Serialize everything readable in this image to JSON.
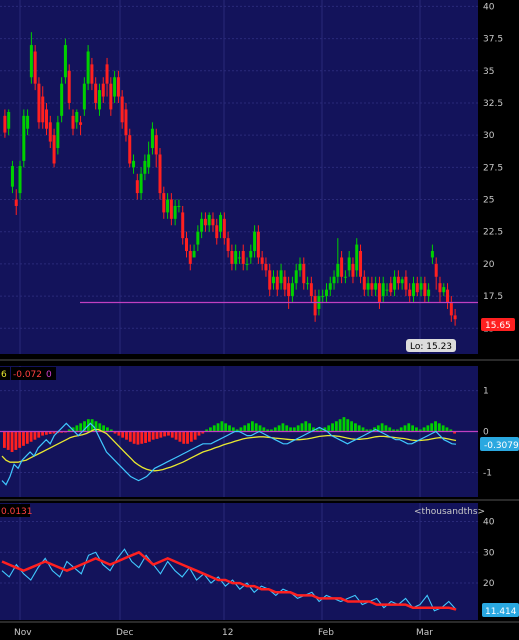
{
  "chart_data": [
    {
      "type": "candlestick",
      "panel": "price",
      "y_ticks": [
        "40",
        "37.5",
        "35",
        "32.5",
        "30",
        "27.5",
        "25",
        "22.5",
        "20",
        "17.5",
        "15"
      ],
      "ylim": [
        13.0,
        40.5
      ],
      "grid": true,
      "x_labels": [
        "Nov",
        "Dec",
        "12",
        "Feb",
        "Mar"
      ],
      "candles": [
        [
          31.5,
          30.2,
          32.0,
          29.8
        ],
        [
          30.5,
          31.8,
          32.0,
          30.0
        ],
        [
          26.0,
          27.6,
          28.0,
          25.5
        ],
        [
          25.0,
          24.5,
          25.8,
          23.8
        ],
        [
          25.5,
          27.6,
          28.0,
          25.0
        ],
        [
          28.0,
          31.5,
          32.0,
          27.5
        ],
        [
          30.5,
          31.5,
          32.0,
          30.0
        ],
        [
          34.5,
          37.0,
          38.0,
          34.0
        ],
        [
          36.5,
          34.0,
          37.0,
          33.5
        ],
        [
          34.0,
          31.0,
          34.5,
          30.5
        ],
        [
          33.0,
          31.0,
          33.8,
          30.5
        ],
        [
          32.0,
          30.5,
          32.5,
          30.0
        ],
        [
          31.0,
          29.5,
          31.5,
          29.0
        ],
        [
          30.0,
          27.8,
          30.5,
          27.5
        ],
        [
          29.0,
          31.0,
          31.5,
          28.5
        ],
        [
          31.5,
          34.0,
          34.5,
          31.0
        ],
        [
          34.5,
          37.0,
          37.5,
          34.0
        ],
        [
          35.0,
          32.5,
          35.5,
          32.0
        ],
        [
          31.5,
          30.5,
          32.0,
          30.0
        ],
        [
          31.0,
          31.8,
          32.0,
          30.5
        ],
        [
          31.0,
          30.8,
          31.5,
          30.0
        ],
        [
          32.0,
          34.0,
          34.5,
          31.5
        ],
        [
          34.0,
          36.5,
          37.0,
          33.5
        ],
        [
          35.5,
          34.0,
          36.0,
          33.5
        ],
        [
          34.0,
          32.5,
          34.5,
          32.0
        ],
        [
          32.0,
          33.5,
          34.0,
          31.5
        ],
        [
          34.0,
          33.0,
          34.5,
          32.5
        ],
        [
          35.5,
          34.0,
          36.0,
          33.0
        ],
        [
          34.0,
          32.0,
          34.5,
          31.5
        ],
        [
          33.0,
          34.5,
          35.0,
          32.5
        ],
        [
          34.5,
          33.0,
          35.0,
          32.5
        ],
        [
          33.0,
          31.0,
          33.5,
          30.5
        ],
        [
          32.0,
          30.0,
          32.5,
          29.5
        ],
        [
          30.0,
          27.8,
          30.5,
          27.5
        ],
        [
          27.5,
          28.0,
          28.5,
          27.0
        ],
        [
          26.5,
          25.5,
          27.0,
          25.0
        ],
        [
          25.5,
          27.0,
          27.5,
          25.0
        ],
        [
          27.0,
          28.0,
          28.5,
          26.5
        ],
        [
          27.5,
          28.5,
          29.5,
          27.0
        ],
        [
          29.0,
          30.5,
          31.0,
          28.5
        ],
        [
          30.0,
          28.5,
          30.5,
          27.5
        ],
        [
          28.5,
          25.5,
          29.0,
          25.0
        ],
        [
          25.5,
          24.0,
          26.0,
          23.5
        ],
        [
          24.0,
          25.0,
          25.5,
          23.5
        ],
        [
          25.0,
          23.5,
          25.5,
          23.0
        ],
        [
          23.5,
          24.5,
          25.0,
          23.0
        ],
        [
          24.5,
          24.5,
          25.0,
          24.0
        ],
        [
          24.0,
          22.0,
          24.5,
          21.5
        ],
        [
          22.0,
          21.0,
          22.5,
          20.5
        ],
        [
          21.0,
          20.0,
          21.5,
          19.5
        ],
        [
          20.5,
          21.0,
          21.5,
          20.5
        ],
        [
          21.5,
          22.5,
          23.0,
          21.0
        ],
        [
          22.5,
          23.5,
          24.0,
          22.0
        ],
        [
          23.5,
          23.0,
          24.0,
          22.5
        ],
        [
          23.0,
          23.8,
          24.0,
          22.5
        ],
        [
          23.5,
          23.0,
          24.0,
          22.5
        ],
        [
          23.0,
          22.0,
          23.5,
          21.5
        ],
        [
          22.5,
          23.8,
          24.0,
          22.0
        ],
        [
          23.5,
          22.0,
          24.0,
          21.5
        ],
        [
          22.0,
          21.0,
          22.5,
          20.5
        ],
        [
          21.0,
          20.0,
          21.5,
          19.5
        ],
        [
          20.0,
          21.0,
          21.5,
          19.5
        ],
        [
          20.5,
          20.5,
          21.0,
          20.0
        ],
        [
          21.0,
          20.0,
          21.5,
          19.5
        ],
        [
          20.0,
          20.0,
          20.5,
          19.5
        ],
        [
          20.5,
          21.0,
          21.5,
          20.0
        ],
        [
          21.0,
          22.5,
          23.0,
          20.5
        ],
        [
          22.5,
          20.5,
          23.0,
          20.0
        ],
        [
          20.5,
          20.0,
          21.0,
          19.5
        ],
        [
          20.0,
          19.5,
          20.5,
          19.0
        ],
        [
          19.5,
          18.0,
          20.0,
          17.5
        ],
        [
          18.5,
          19.0,
          19.5,
          18.0
        ],
        [
          19.0,
          18.0,
          19.5,
          17.5
        ],
        [
          18.5,
          19.5,
          20.0,
          18.0
        ],
        [
          19.0,
          18.0,
          19.5,
          17.5
        ],
        [
          18.5,
          17.5,
          19.0,
          16.5
        ],
        [
          17.5,
          18.5,
          19.0,
          17.0
        ],
        [
          18.5,
          19.5,
          20.0,
          18.0
        ],
        [
          19.5,
          20.0,
          20.5,
          19.0
        ],
        [
          20.0,
          18.5,
          20.5,
          18.0
        ],
        [
          18.5,
          18.5,
          19.0,
          18.0
        ],
        [
          18.5,
          17.5,
          19.0,
          17.0
        ],
        [
          17.5,
          16.0,
          18.0,
          15.5
        ],
        [
          16.5,
          17.5,
          18.0,
          16.0
        ],
        [
          17.5,
          17.5,
          18.0,
          17.0
        ],
        [
          17.5,
          18.0,
          18.5,
          17.0
        ],
        [
          18.0,
          18.5,
          19.0,
          17.5
        ],
        [
          18.5,
          19.0,
          19.5,
          18.0
        ],
        [
          19.0,
          20.0,
          22.0,
          18.5
        ],
        [
          20.5,
          19.0,
          21.0,
          18.5
        ],
        [
          19.0,
          19.0,
          19.5,
          18.5
        ],
        [
          19.5,
          20.5,
          21.0,
          19.0
        ],
        [
          20.0,
          19.0,
          20.5,
          18.5
        ],
        [
          19.5,
          21.5,
          22.0,
          19.0
        ],
        [
          21.0,
          19.0,
          21.5,
          18.5
        ],
        [
          19.0,
          18.0,
          19.5,
          17.5
        ],
        [
          18.0,
          18.5,
          19.0,
          17.5
        ],
        [
          18.5,
          18.0,
          19.0,
          17.5
        ],
        [
          18.0,
          18.5,
          19.0,
          17.5
        ],
        [
          18.5,
          17.0,
          19.0,
          16.5
        ],
        [
          17.5,
          18.5,
          19.0,
          17.0
        ],
        [
          18.0,
          18.0,
          18.5,
          17.5
        ],
        [
          18.5,
          17.8,
          19.0,
          17.5
        ],
        [
          18.0,
          19.0,
          19.5,
          17.5
        ],
        [
          19.0,
          18.5,
          19.5,
          18.0
        ],
        [
          18.5,
          18.8,
          19.0,
          18.0
        ],
        [
          19.0,
          18.0,
          19.5,
          17.5
        ],
        [
          18.0,
          17.5,
          18.5,
          17.0
        ],
        [
          17.5,
          18.5,
          19.0,
          17.0
        ],
        [
          18.5,
          17.8,
          19.0,
          17.5
        ],
        [
          18.0,
          18.5,
          19.0,
          17.5
        ],
        [
          18.5,
          17.5,
          19.0,
          17.0
        ],
        [
          17.5,
          18.0,
          18.5,
          17.0
        ],
        [
          20.5,
          21.0,
          21.5,
          20.0
        ],
        [
          20.0,
          19.0,
          20.5,
          18.0
        ],
        [
          18.5,
          17.8,
          19.0,
          17.0
        ],
        [
          17.8,
          18.2,
          18.5,
          17.5
        ],
        [
          18.0,
          17.0,
          18.5,
          16.5
        ],
        [
          17.0,
          16.0,
          17.5,
          15.5
        ],
        [
          16.0,
          15.7,
          16.5,
          15.2
        ]
      ],
      "horizontal_line": 17.0,
      "last_price_label": "15.65",
      "low_label": "Lo: 15.23",
      "colors": {
        "up": "#00d000",
        "down": "#ff2020",
        "background": "#13135b",
        "grid": "#2a2a7a",
        "line": "#c040c0",
        "last": "#ff2020"
      }
    },
    {
      "type": "macd",
      "panel": "macd",
      "header_values": [
        "6",
        "-0.072",
        "0"
      ],
      "y_ticks": [
        "1",
        "0",
        "-1"
      ],
      "ylim": [
        -1.6,
        1.6
      ],
      "last_value_label": "-0.3079",
      "histogram": [
        -0.4,
        -0.45,
        -0.5,
        -0.45,
        -0.4,
        -0.35,
        -0.3,
        -0.25,
        -0.2,
        -0.15,
        -0.1,
        -0.08,
        -0.06,
        -0.05,
        -0.04,
        -0.03,
        -0.02,
        0.05,
        0.1,
        0.15,
        0.2,
        0.25,
        0.3,
        0.3,
        0.25,
        0.2,
        0.15,
        0.1,
        0.05,
        -0.05,
        -0.1,
        -0.15,
        -0.2,
        -0.25,
        -0.3,
        -0.32,
        -0.3,
        -0.28,
        -0.25,
        -0.2,
        -0.18,
        -0.15,
        -0.12,
        -0.1,
        -0.15,
        -0.2,
        -0.25,
        -0.3,
        -0.3,
        -0.25,
        -0.2,
        -0.1,
        -0.05,
        0.05,
        0.1,
        0.15,
        0.2,
        0.25,
        0.2,
        0.15,
        0.1,
        0.05,
        0.1,
        0.15,
        0.2,
        0.25,
        0.2,
        0.15,
        0.1,
        0.05,
        0.05,
        0.1,
        0.15,
        0.2,
        0.15,
        0.1,
        0.1,
        0.15,
        0.2,
        0.25,
        0.2,
        0.1,
        0.05,
        0.05,
        0.1,
        0.15,
        0.2,
        0.25,
        0.3,
        0.35,
        0.3,
        0.25,
        0.2,
        0.15,
        0.1,
        0.05,
        0.05,
        0.1,
        0.15,
        0.2,
        0.15,
        0.1,
        0.05,
        0.05,
        0.1,
        0.15,
        0.2,
        0.15,
        0.1,
        0.05,
        0.1,
        0.15,
        0.2,
        0.25,
        0.2,
        0.15,
        0.1,
        0.05,
        -0.05
      ],
      "macd_line": [
        -1.2,
        -1.3,
        -1.1,
        -0.8,
        -0.9,
        -0.7,
        -0.6,
        -0.5,
        -0.6,
        -0.4,
        -0.3,
        -0.2,
        -0.3,
        -0.1,
        0.0,
        0.1,
        0.2,
        0.1,
        0.0,
        -0.1,
        0.0,
        0.1,
        0.2,
        0.1,
        -0.1,
        -0.3,
        -0.5,
        -0.6,
        -0.7,
        -0.8,
        -0.9,
        -1.0,
        -1.1,
        -1.15,
        -1.2,
        -1.15,
        -1.1,
        -1.0,
        -0.9,
        -0.85,
        -0.8,
        -0.75,
        -0.7,
        -0.65,
        -0.6,
        -0.55,
        -0.5,
        -0.45,
        -0.4,
        -0.35,
        -0.3,
        -0.3,
        -0.3,
        -0.25,
        -0.2,
        -0.15,
        -0.1,
        -0.05,
        0.0,
        0.0,
        -0.05,
        -0.1,
        -0.1,
        -0.05,
        0.0,
        -0.05,
        -0.1,
        -0.15,
        -0.2,
        -0.25,
        -0.3,
        -0.3,
        -0.25,
        -0.2,
        -0.15,
        -0.1,
        -0.05,
        0.0,
        0.05,
        0.1,
        0.05,
        0.0,
        -0.1,
        -0.15,
        -0.2,
        -0.25,
        -0.3,
        -0.25,
        -0.2,
        -0.15,
        -0.1,
        -0.05,
        0.0,
        0.05,
        0.0,
        -0.05,
        -0.1,
        -0.15,
        -0.2,
        -0.2,
        -0.25,
        -0.3,
        -0.3,
        -0.25,
        -0.2,
        -0.15,
        -0.1,
        -0.05,
        0.0,
        -0.1,
        -0.2,
        -0.25,
        -0.3,
        -0.31
      ],
      "signal_line": [
        -0.6,
        -0.7,
        -0.75,
        -0.75,
        -0.75,
        -0.72,
        -0.7,
        -0.65,
        -0.6,
        -0.55,
        -0.5,
        -0.45,
        -0.4,
        -0.35,
        -0.3,
        -0.25,
        -0.2,
        -0.15,
        -0.12,
        -0.1,
        -0.08,
        -0.05,
        0.0,
        0.05,
        0.05,
        0.0,
        -0.05,
        -0.15,
        -0.25,
        -0.35,
        -0.45,
        -0.55,
        -0.65,
        -0.75,
        -0.82,
        -0.88,
        -0.92,
        -0.95,
        -0.96,
        -0.95,
        -0.93,
        -0.9,
        -0.87,
        -0.83,
        -0.79,
        -0.75,
        -0.7,
        -0.65,
        -0.6,
        -0.55,
        -0.5,
        -0.47,
        -0.44,
        -0.4,
        -0.37,
        -0.33,
        -0.3,
        -0.27,
        -0.24,
        -0.21,
        -0.18,
        -0.16,
        -0.15,
        -0.14,
        -0.13,
        -0.13,
        -0.14,
        -0.15,
        -0.16,
        -0.17,
        -0.18,
        -0.19,
        -0.2,
        -0.2,
        -0.2,
        -0.19,
        -0.18,
        -0.16,
        -0.14,
        -0.12,
        -0.11,
        -0.1,
        -0.1,
        -0.11,
        -0.12,
        -0.14,
        -0.16,
        -0.18,
        -0.19,
        -0.19,
        -0.18,
        -0.17,
        -0.15,
        -0.13,
        -0.12,
        -0.12,
        -0.13,
        -0.14,
        -0.15,
        -0.16,
        -0.17,
        -0.19,
        -0.21,
        -0.22,
        -0.22,
        -0.21,
        -0.2,
        -0.18,
        -0.16,
        -0.15,
        -0.16,
        -0.18,
        -0.2,
        -0.22
      ],
      "colors": {
        "hist_up": "#00d000",
        "hist_down": "#ff2020",
        "macd": "#40c8ff",
        "signal": "#e8e830",
        "zero": "#c040c0",
        "background": "#13135b"
      }
    },
    {
      "type": "line",
      "panel": "lower",
      "header_value": "0.0131",
      "header_units": "<thousandths>",
      "y_ticks": [
        "40",
        "30",
        "20"
      ],
      "ylim": [
        8,
        46
      ],
      "last_value_label": "11.414",
      "series_a": [
        27,
        26,
        25,
        24,
        25,
        26,
        27,
        26,
        25,
        24,
        25,
        26,
        27,
        28,
        27,
        26,
        27,
        28,
        29,
        30,
        28,
        26,
        27,
        28,
        27,
        26,
        25,
        24,
        23,
        22,
        21,
        21,
        20,
        20,
        19,
        19,
        18,
        18,
        17,
        17,
        17,
        16,
        16,
        16,
        15,
        15,
        15,
        15,
        14,
        14,
        14,
        14,
        13,
        13,
        13,
        13,
        13,
        12,
        12,
        12,
        12,
        12,
        12,
        11.4
      ],
      "series_b": [
        24,
        22,
        26,
        23,
        21,
        25,
        28,
        24,
        22,
        27,
        25,
        23,
        29,
        30,
        26,
        24,
        28,
        31,
        27,
        25,
        29,
        26,
        23,
        27,
        24,
        22,
        25,
        21,
        23,
        20,
        22,
        19,
        21,
        18,
        20,
        17,
        19,
        18,
        16,
        18,
        17,
        15,
        16,
        17,
        14,
        16,
        15,
        14,
        15,
        16,
        13,
        14,
        15,
        12,
        14,
        13,
        15,
        12,
        13,
        16,
        11,
        12,
        14,
        11.4
      ],
      "colors": {
        "a": "#ff2020",
        "b": "#40c8ff",
        "background": "#13135b",
        "grid": "#2a2a7a"
      }
    }
  ]
}
